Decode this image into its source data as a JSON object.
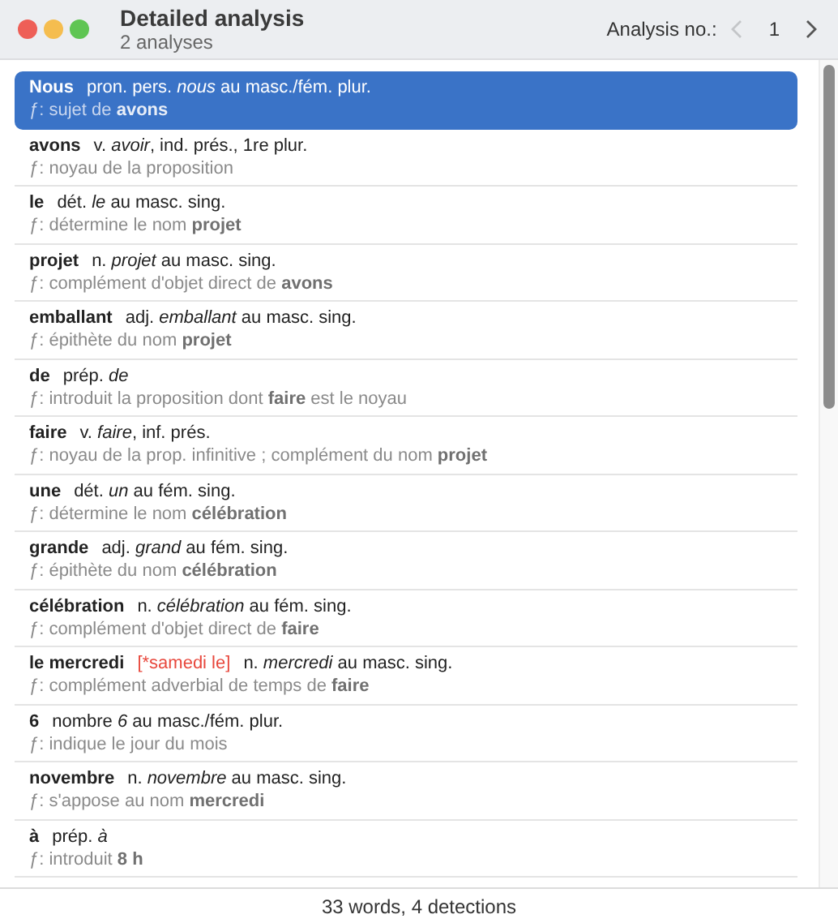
{
  "window": {
    "title": "Detailed analysis",
    "subtitle": "2 analyses"
  },
  "navigator": {
    "label": "Analysis no.:",
    "value": "1"
  },
  "analysis_rows": [
    {
      "word": "Nous",
      "pos": "pron. pers. *nous* au masc./fém. plur.",
      "function": "ƒ: sujet de **avons**",
      "selected": true
    },
    {
      "word": "avons",
      "pos": "v. *avoir*, ind. prés., 1re plur.",
      "function": "ƒ: noyau de la proposition",
      "selected": false
    },
    {
      "word": "le",
      "pos": "dét. *le* au masc. sing.",
      "function": "ƒ: détermine le nom **projet**",
      "selected": false
    },
    {
      "word": "projet",
      "pos": "n. *projet* au masc. sing.",
      "function": "ƒ: complément d'objet direct de **avons**",
      "selected": false
    },
    {
      "word": "emballant",
      "pos": "adj. *emballant* au masc. sing.",
      "function": "ƒ: épithète du nom **projet**",
      "selected": false
    },
    {
      "word": "de",
      "pos": "prép. *de*",
      "function": "ƒ: introduit la proposition dont **faire** est le noyau",
      "selected": false
    },
    {
      "word": "faire",
      "pos": "v. *faire*, inf. prés.",
      "function": "ƒ: noyau de la prop. infinitive ; complément du nom **projet**",
      "selected": false
    },
    {
      "word": "une",
      "pos": "dét. *un* au fém. sing.",
      "function": "ƒ: détermine le nom **célébration**",
      "selected": false
    },
    {
      "word": "grande",
      "pos": "adj. *grand* au fém. sing.",
      "function": "ƒ: épithète du nom **célébration**",
      "selected": false
    },
    {
      "word": "célébration",
      "pos": "n. *célébration* au fém. sing.",
      "function": "ƒ: complément d'objet direct de **faire**",
      "selected": false
    },
    {
      "word": "le mercredi",
      "correction": "[*samedi le]",
      "pos": "n. *mercredi* au masc. sing.",
      "function": "ƒ: complément adverbial de temps de **faire**",
      "selected": false
    },
    {
      "word": "6",
      "pos": "nombre *6* au masc./fém. plur.",
      "function": "ƒ: indique le jour du mois",
      "selected": false
    },
    {
      "word": "novembre",
      "pos": "n. *novembre* au masc. sing.",
      "function": "ƒ: s'appose au nom **mercredi**",
      "selected": false
    },
    {
      "word": "à",
      "pos": "prép. *à*",
      "function": "ƒ: introduit **8 h**",
      "selected": false
    }
  ],
  "status_bar": "33 words, 4 detections"
}
